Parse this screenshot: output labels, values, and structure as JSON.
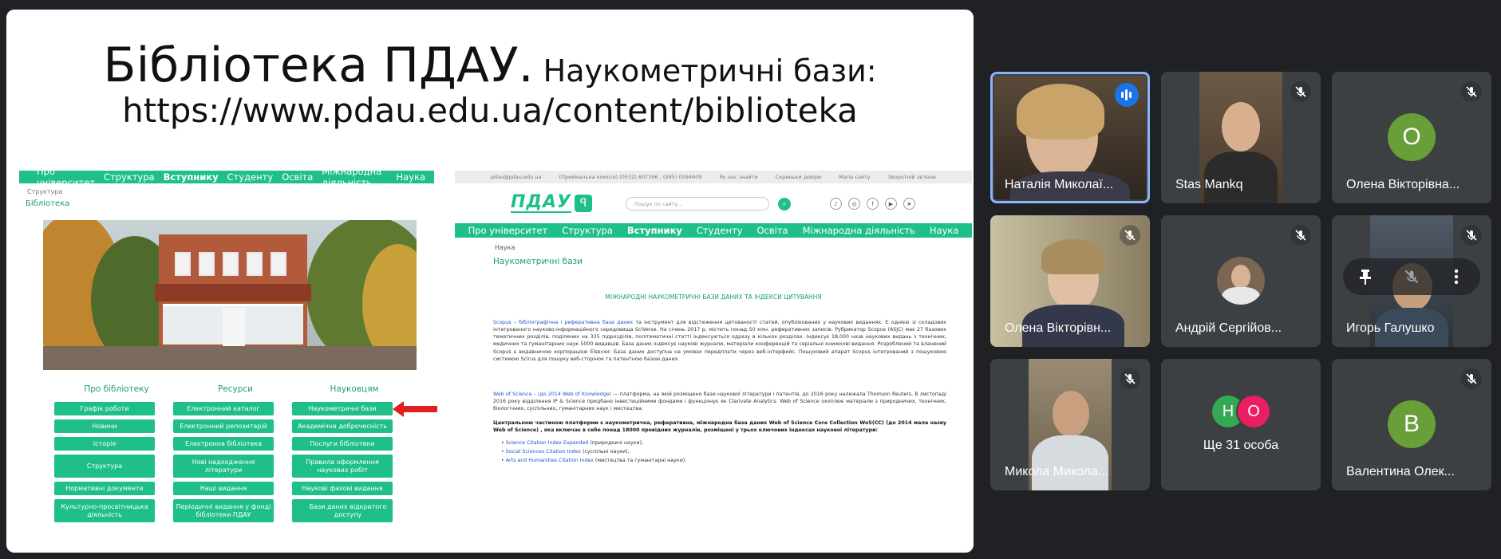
{
  "slide": {
    "title_big": "Бібліотека ПДАУ.",
    "title_medium": " Наукометричні бази:",
    "url": "https://www.pdau.edu.ua/content/biblioteka"
  },
  "site_left": {
    "nav": [
      "Про університет",
      "Структура",
      "Вступнику",
      "Студенту",
      "Освіта",
      "Міжнародна діяльність",
      "Наука"
    ],
    "breadcrumb": "Структура",
    "title": "Бібліотека",
    "columns": [
      {
        "heading": "Про бібліотеку",
        "buttons": [
          "Графік роботи",
          "Новини",
          "Історія",
          "Структура",
          "Нормативні документи",
          "Культурно-просвітницька діяльність"
        ]
      },
      {
        "heading": "Ресурси",
        "buttons": [
          "Електронний каталог",
          "Електронний репозитарій",
          "Електронна бібліотека",
          "Нові надходження літератури",
          "Наші видання",
          "Періодичні видання у фонді бібліотеки ПДАУ"
        ]
      },
      {
        "heading": "Науковцям",
        "buttons": [
          "Наукометричні бази",
          "Академічна доброчесність",
          "Послуги бібліотеки",
          "Правила оформлення наукових робіт",
          "Наукові фахові видання",
          "Бази даних відкритого доступу"
        ]
      }
    ]
  },
  "site_right": {
    "topbar": [
      "pdau@pdau.edu.ua",
      "(Приймальна комісія) (0532) 607396 , (095) 0594609",
      "Як нас знайти",
      "Скриньки довіри",
      "Мапа сайту",
      "Зворотній зв'язок"
    ],
    "logo": "ПДАУ",
    "search_placeholder": "Пошук по сайту...",
    "nav": [
      "Про університет",
      "Структура",
      "Вступнику",
      "Студенту",
      "Освіта",
      "Міжнародна діяльність",
      "Наука"
    ],
    "breadcrumb": "Наука",
    "title": "Наукометричні бази",
    "section_heading": "МІЖНАРОДНІ НАУКОМЕТРИЧНІ БАЗИ ДАНИХ ТА ІНДЕКСИ ЦИТУВАННЯ",
    "scopus_link": "Scopus – бібліографічна і реферативна база даних",
    "scopus_text": " та інструмент для відстеження цитованості статей, опублікованих у наукових виданнях. Є однією зі складових інтегрованого науково-інформаційного середовища SciVerse. На січень 2017 р. містить понад 50 млн. реферативних записів. Рубрикатор Scopus (ASJC) має 27 базових тематичних розділів, поділених на 335 підрозділів, політематичні статті індексуються одразу в кількох розділах. Індексує 18,000 назв наукових видань з технічних, медичних та гуманітарних наук 5000 видавців. База даних індексує наукові журнали, матеріали конференцій та серіальні книжкові видання. Розроблений та вланений Scopus є видавничою корпорацією Elsevier. База даних доступна на умовах передплати через веб-інтерфейс. Пошуковий апарат Scopus інтегрований з пошуковою системою Scirus для пошуку веб-сторінок та патентною базою даних.",
    "wos_link": "Web of Science – (до 2014 Web of Knowledge)",
    "wos_text": " — платформа, на якій розміщено бази наукової літератури і патентів, до 2016 року належала Thomson Reuters. В листопаді 2016 року відділення IP & Science придбано інвестиційними фондами і функціонує як Clarivate Analytics. Web of Science охоплює матеріали з природничих, технічних, біологічних, суспільних, гуманітарних наук і мистецтва.",
    "core_text": "Центральною частиною платформи є наукометрична, реферативна, міжнародна база даних Web of Science Core Collection WoS(CC) (до 2014 мала назву Web of Science) , яка включає в себе понад 18000 провідних журналів, розміщені у трьох ключових індексах наукової літератури:",
    "indexes": [
      {
        "link": "Science Citation Index Expanded",
        "note": " (природничі науки),",
        "n": "1"
      },
      {
        "link": "Social Sciences Citation Index",
        "note": " (суспільні науки),",
        "n": "2"
      },
      {
        "link": "Arts and Humanities Citation Index",
        "note": " (мистецтва та гуманітарні науки).",
        "n": "3"
      }
    ]
  },
  "participants": [
    {
      "name": "Наталія Миколаї...",
      "type": "video",
      "speaking": true
    },
    {
      "name": "Stas Mankq",
      "type": "video",
      "muted": true
    },
    {
      "name": "Олена Вікторівна...",
      "type": "avatar",
      "initial": "О",
      "color": "#689f38",
      "muted": true
    },
    {
      "name": "Олена Вікторівн...",
      "type": "video",
      "muted": true
    },
    {
      "name": "Андрій Сергійов...",
      "type": "photo",
      "muted": true
    },
    {
      "name": "Игорь Галушко",
      "type": "video",
      "muted": true,
      "hovered": true
    },
    {
      "name": "Микола Микола...",
      "type": "video",
      "muted": true
    },
    {
      "name": "Ще 31 особа",
      "type": "group",
      "initials": [
        "Н",
        "О"
      ],
      "colors": [
        "#34a853",
        "#e91e63"
      ]
    },
    {
      "name": "Валентина Олек...",
      "type": "avatar",
      "initial": "В",
      "color": "#689f38",
      "muted": true
    }
  ],
  "colors": {
    "accent": "#1fbf8a",
    "tile_bg": "#3c4043",
    "page_bg": "#202124",
    "speaking_border": "#8ab4f8"
  },
  "icons": [
    "mic-off-icon",
    "speaking-indicator-icon",
    "pin-icon",
    "more-options-icon",
    "search-icon",
    "red-arrow-icon"
  ]
}
